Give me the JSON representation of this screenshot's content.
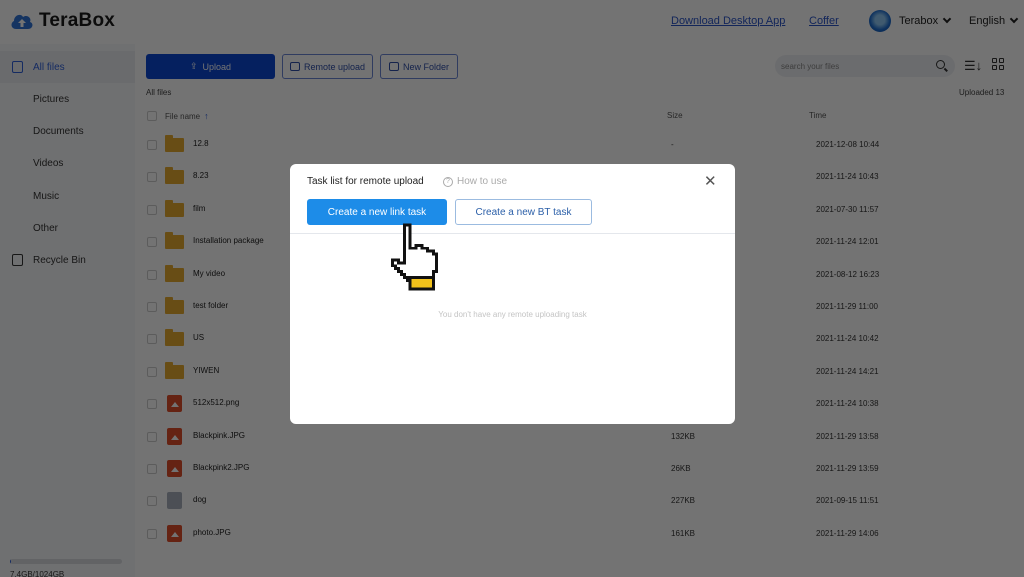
{
  "header": {
    "app_name": "TeraBox",
    "links": [
      "Download Desktop App",
      "Coffer"
    ],
    "user_name": "Terabox",
    "language": "English"
  },
  "sidebar": {
    "items": [
      {
        "label": "All files",
        "active": true
      },
      {
        "label": "Pictures"
      },
      {
        "label": "Documents"
      },
      {
        "label": "Videos"
      },
      {
        "label": "Music"
      },
      {
        "label": "Other"
      },
      {
        "label": "Recycle Bin"
      }
    ],
    "storage": {
      "text": "7.4GB/1024GB",
      "used_fraction": 0.007
    }
  },
  "toolbar": {
    "upload_label": "Upload",
    "remote_upload_label": "Remote upload",
    "new_folder_label": "New Folder",
    "search_placeholder": "search your files"
  },
  "breadcrumb": "All files",
  "uploaded_count": "Uploaded 13",
  "table": {
    "headers": {
      "name": "File name",
      "size": "Size",
      "time": "Time"
    },
    "rows": [
      {
        "name": "12.8",
        "type": "folder",
        "size": "-",
        "time": "2021-12-08 10:44"
      },
      {
        "name": "8.23",
        "type": "folder",
        "size": "",
        "time": "2021-11-24 10:43"
      },
      {
        "name": "film",
        "type": "folder",
        "size": "",
        "time": "2021-07-30 11:57"
      },
      {
        "name": "Installation package",
        "type": "folder",
        "size": "",
        "time": "2021-11-24 12:01"
      },
      {
        "name": "My video",
        "type": "folder",
        "size": "",
        "time": "2021-08-12 16:23"
      },
      {
        "name": "test folder",
        "type": "folder",
        "size": "",
        "time": "2021-11-29 11:00"
      },
      {
        "name": "US",
        "type": "folder",
        "size": "",
        "time": "2021-11-24 10:42"
      },
      {
        "name": "YIWEN",
        "type": "folder",
        "size": "",
        "time": "2021-11-24 14:21"
      },
      {
        "name": "512x512.png",
        "type": "image",
        "size": "",
        "time": "2021-11-24 10:38"
      },
      {
        "name": "Blackpink.JPG",
        "type": "image",
        "size": "132KB",
        "time": "2021-11-29 13:58"
      },
      {
        "name": "Blackpink2.JPG",
        "type": "image",
        "size": "26KB",
        "time": "2021-11-29 13:59"
      },
      {
        "name": "dog",
        "type": "file",
        "size": "227KB",
        "time": "2021-09-15 11:51"
      },
      {
        "name": "photo.JPG",
        "type": "image",
        "size": "161KB",
        "time": "2021-11-29 14:06"
      }
    ]
  },
  "modal": {
    "title": "Task list for remote upload",
    "help_label": "How to use",
    "close_glyph": "✕",
    "primary_button": "Create a new link task",
    "secondary_button": "Create a new BT task",
    "empty_text": "You don't have any remote uploading task"
  },
  "colors": {
    "brand": "#0c47d3",
    "modal_primary": "#1d8ce8",
    "folder": "#e7ac2f",
    "image_file": "#e04e2a"
  }
}
